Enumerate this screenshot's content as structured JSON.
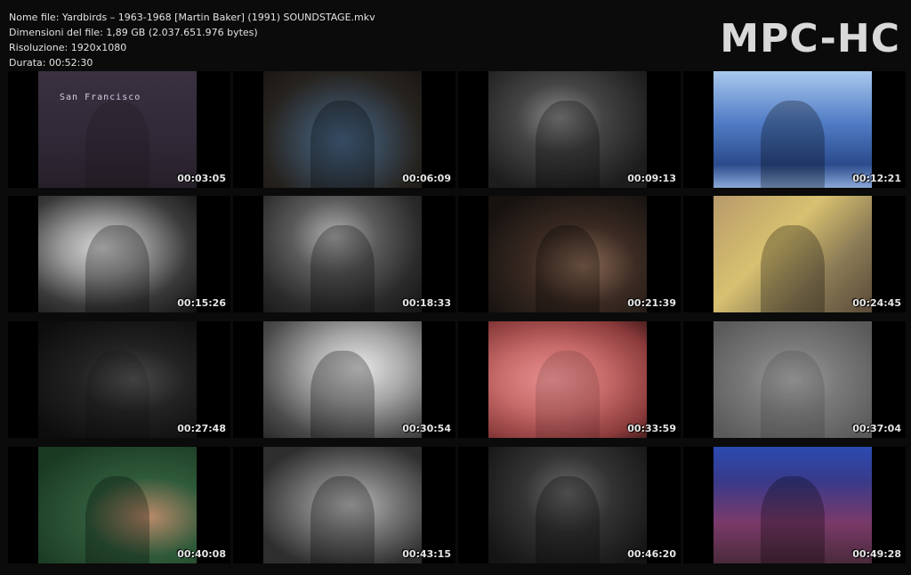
{
  "file_info": {
    "name_line": "Nome file: Yardbirds – 1963-1968 [Martin Baker] (1991) SOUNDSTAGE.mkv",
    "size_line": "Dimensioni del file: 1,89 GB (2.037.651.976 bytes)",
    "resolution_line": "Risoluzione: 1920x1080",
    "duration_line": "Durata: 00:52:30"
  },
  "logo": "MPC-HC",
  "thumbnails": [
    {
      "time": "00:03:05",
      "caption": "San Francisco",
      "palette": "purple"
    },
    {
      "time": "00:06:09",
      "palette": "interview-studio"
    },
    {
      "time": "00:09:13",
      "palette": "bw-stage"
    },
    {
      "time": "00:12:21",
      "palette": "blue-forest"
    },
    {
      "time": "00:15:26",
      "palette": "bw-closeup"
    },
    {
      "time": "00:18:33",
      "palette": "bw-band"
    },
    {
      "time": "00:21:39",
      "palette": "interview-painting"
    },
    {
      "time": "00:24:45",
      "palette": "yellow-collage"
    },
    {
      "time": "00:27:48",
      "palette": "dark-bw"
    },
    {
      "time": "00:30:54",
      "palette": "bw-singer"
    },
    {
      "time": "00:33:59",
      "palette": "red-abstract"
    },
    {
      "time": "00:37:04",
      "palette": "grey-grid"
    },
    {
      "time": "00:40:08",
      "palette": "green-interview"
    },
    {
      "time": "00:43:15",
      "palette": "bw-guitar"
    },
    {
      "time": "00:46:20",
      "palette": "bw-concert"
    },
    {
      "time": "00:49:28",
      "palette": "sofa-group"
    }
  ]
}
